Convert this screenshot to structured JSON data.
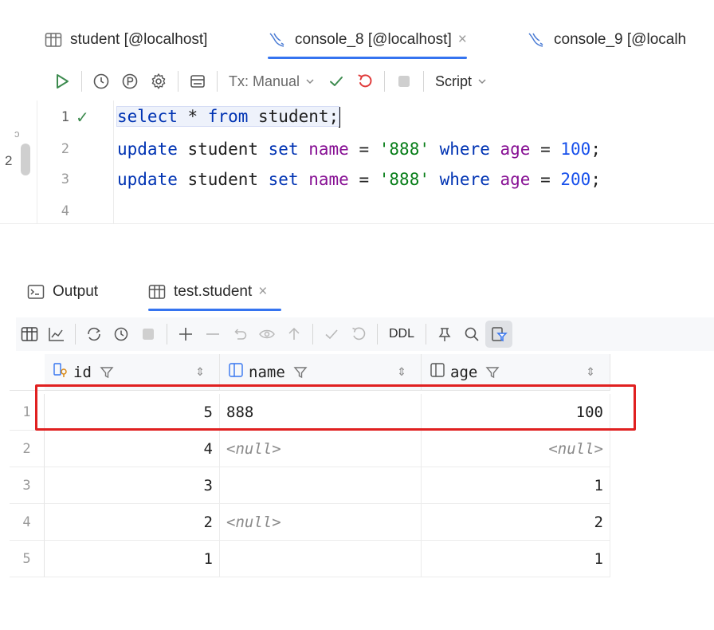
{
  "editor_tabs": [
    {
      "label": "student [@localhost]",
      "icon": "table-icon",
      "active": false
    },
    {
      "label": "console_8 [@localhost]",
      "icon": "mysql-icon",
      "active": true,
      "close": "×"
    },
    {
      "label": "console_9 [@localh",
      "icon": "mysql-icon",
      "active": false
    }
  ],
  "toolbar": {
    "tx_label": "Tx: Manual",
    "script_label": "Script",
    "colors": {
      "run": "#3d8b4f",
      "commit": "#3d8b4f",
      "rollback": "#e03b3b"
    }
  },
  "gutter_fragments": {
    "top": "ɔ",
    "bottom": "2"
  },
  "editor": {
    "lines": [
      {
        "num": "1",
        "check": "✓",
        "tokens": [
          {
            "t": "select",
            "c": "kw"
          },
          {
            "t": " * ",
            "c": ""
          },
          {
            "t": "from",
            "c": "kw"
          },
          {
            "t": " student;",
            "c": ""
          }
        ]
      },
      {
        "num": "2",
        "tokens": [
          {
            "t": "update",
            "c": "kw"
          },
          {
            "t": " student ",
            "c": ""
          },
          {
            "t": "set",
            "c": "kw"
          },
          {
            "t": " ",
            "c": ""
          },
          {
            "t": "name",
            "c": "col"
          },
          {
            "t": " = ",
            "c": ""
          },
          {
            "t": "'888'",
            "c": "str"
          },
          {
            "t": " ",
            "c": ""
          },
          {
            "t": "where",
            "c": "kw"
          },
          {
            "t": " ",
            "c": ""
          },
          {
            "t": "age",
            "c": "col"
          },
          {
            "t": " = ",
            "c": ""
          },
          {
            "t": "100",
            "c": "num"
          },
          {
            "t": ";",
            "c": ""
          }
        ]
      },
      {
        "num": "3",
        "tokens": [
          {
            "t": "update",
            "c": "kw"
          },
          {
            "t": " student ",
            "c": ""
          },
          {
            "t": "set",
            "c": "kw"
          },
          {
            "t": " ",
            "c": ""
          },
          {
            "t": "name",
            "c": "col"
          },
          {
            "t": " = ",
            "c": ""
          },
          {
            "t": "'888'",
            "c": "str"
          },
          {
            "t": " ",
            "c": ""
          },
          {
            "t": "where",
            "c": "kw"
          },
          {
            "t": " ",
            "c": ""
          },
          {
            "t": "age",
            "c": "col"
          },
          {
            "t": " = ",
            "c": ""
          },
          {
            "t": "200",
            "c": "num"
          },
          {
            "t": ";",
            "c": ""
          }
        ]
      },
      {
        "num": "4",
        "tokens": []
      }
    ]
  },
  "result_tabs": [
    {
      "label": "Output",
      "icon": "terminal-icon",
      "active": false
    },
    {
      "label": "test.student",
      "icon": "table-icon",
      "active": true,
      "close": "×"
    }
  ],
  "result_toolbar": {
    "ddl_label": "DDL"
  },
  "grid": {
    "columns": [
      {
        "name": "id",
        "icon": "key-column-icon",
        "sort": "⇕"
      },
      {
        "name": "name",
        "icon": "column-icon",
        "sort": "⇕"
      },
      {
        "name": "age",
        "icon": "column-icon",
        "sort": "⇕"
      }
    ],
    "rows": [
      {
        "num": "1",
        "id": "5",
        "name": "888",
        "age": "100",
        "name_null": false,
        "age_null": false
      },
      {
        "num": "2",
        "id": "4",
        "name": "<null>",
        "age": "<null>",
        "name_null": true,
        "age_null": true
      },
      {
        "num": "3",
        "id": "3",
        "name": "",
        "age": "1",
        "name_null": false,
        "age_null": false
      },
      {
        "num": "4",
        "id": "2",
        "name": "<null>",
        "age": "2",
        "name_null": true,
        "age_null": false
      },
      {
        "num": "5",
        "id": "1",
        "name": "",
        "age": "1",
        "name_null": false,
        "age_null": false
      }
    ],
    "highlight_color": "#e02020"
  }
}
